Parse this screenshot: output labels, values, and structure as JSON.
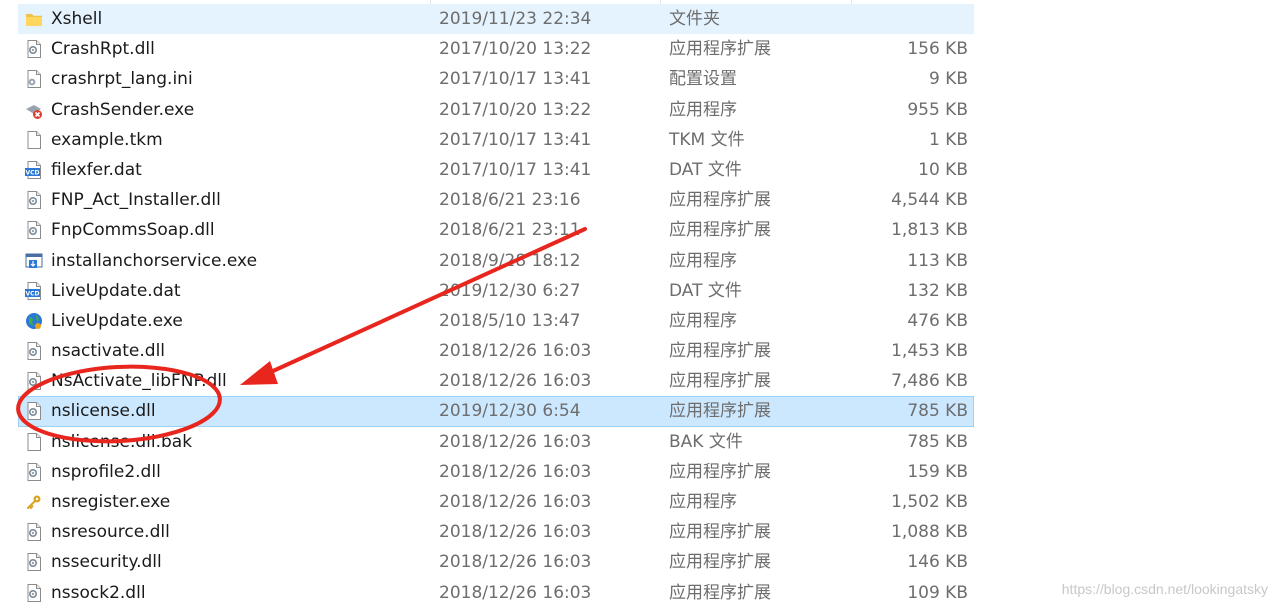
{
  "files": [
    {
      "name": "Xshell",
      "date": "2019/11/23 22:34",
      "type": "文件夹",
      "size": "",
      "icon": "folder-icon",
      "state": "hover"
    },
    {
      "name": "CrashRpt.dll",
      "date": "2017/10/20 13:22",
      "type": "应用程序扩展",
      "size": "156 KB",
      "icon": "dll-file-icon",
      "state": ""
    },
    {
      "name": "crashrpt_lang.ini",
      "date": "2017/10/17 13:41",
      "type": "配置设置",
      "size": "9 KB",
      "icon": "ini-settings-icon",
      "state": ""
    },
    {
      "name": "CrashSender.exe",
      "date": "2017/10/20 13:22",
      "type": "应用程序",
      "size": "955 KB",
      "icon": "crash-sender-exe-icon",
      "state": ""
    },
    {
      "name": "example.tkm",
      "date": "2017/10/17 13:41",
      "type": "TKM 文件",
      "size": "1 KB",
      "icon": "blank-file-icon",
      "state": ""
    },
    {
      "name": "filexfer.dat",
      "date": "2017/10/17 13:41",
      "type": "DAT 文件",
      "size": "10 KB",
      "icon": "vcd-file-icon",
      "state": ""
    },
    {
      "name": "FNP_Act_Installer.dll",
      "date": "2018/6/21 23:16",
      "type": "应用程序扩展",
      "size": "4,544 KB",
      "icon": "dll-file-icon",
      "state": ""
    },
    {
      "name": "FnpCommsSoap.dll",
      "date": "2018/6/21 23:11",
      "type": "应用程序扩展",
      "size": "1,813 KB",
      "icon": "dll-file-icon",
      "state": ""
    },
    {
      "name": "installanchorservice.exe",
      "date": "2018/9/28 18:12",
      "type": "应用程序",
      "size": "113 KB",
      "icon": "installer-exe-icon",
      "state": ""
    },
    {
      "name": "LiveUpdate.dat",
      "date": "2019/12/30 6:27",
      "type": "DAT 文件",
      "size": "132 KB",
      "icon": "vcd-file-icon",
      "state": ""
    },
    {
      "name": "LiveUpdate.exe",
      "date": "2018/5/10 13:47",
      "type": "应用程序",
      "size": "476 KB",
      "icon": "globe-exe-icon",
      "state": ""
    },
    {
      "name": "nsactivate.dll",
      "date": "2018/12/26 16:03",
      "type": "应用程序扩展",
      "size": "1,453 KB",
      "icon": "dll-file-icon",
      "state": ""
    },
    {
      "name": "NsActivate_libFNP.dll",
      "date": "2018/12/26 16:03",
      "type": "应用程序扩展",
      "size": "7,486 KB",
      "icon": "dll-file-icon",
      "state": ""
    },
    {
      "name": "nslicense.dll",
      "date": "2019/12/30 6:54",
      "type": "应用程序扩展",
      "size": "785 KB",
      "icon": "dll-file-icon",
      "state": "selected"
    },
    {
      "name": "nslicense.dll.bak",
      "date": "2018/12/26 16:03",
      "type": "BAK 文件",
      "size": "785 KB",
      "icon": "blank-file-icon",
      "state": ""
    },
    {
      "name": "nsprofile2.dll",
      "date": "2018/12/26 16:03",
      "type": "应用程序扩展",
      "size": "159 KB",
      "icon": "dll-file-icon",
      "state": ""
    },
    {
      "name": "nsregister.exe",
      "date": "2018/12/26 16:03",
      "type": "应用程序",
      "size": "1,502 KB",
      "icon": "key-exe-icon",
      "state": ""
    },
    {
      "name": "nsresource.dll",
      "date": "2018/12/26 16:03",
      "type": "应用程序扩展",
      "size": "1,088 KB",
      "icon": "dll-file-icon",
      "state": ""
    },
    {
      "name": "nssecurity.dll",
      "date": "2018/12/26 16:03",
      "type": "应用程序扩展",
      "size": "146 KB",
      "icon": "dll-file-icon",
      "state": ""
    },
    {
      "name": "nssock2.dll",
      "date": "2018/12/26 16:03",
      "type": "应用程序扩展",
      "size": "109 KB",
      "icon": "dll-file-icon",
      "state": ""
    }
  ],
  "watermark": "https://blog.csdn.net/lookingatsky",
  "colors": {
    "selected_row": "#cce8ff",
    "hover_row": "#e5f3ff",
    "annotation": "#e8261e",
    "secondary_text": "#6d6d6d"
  }
}
